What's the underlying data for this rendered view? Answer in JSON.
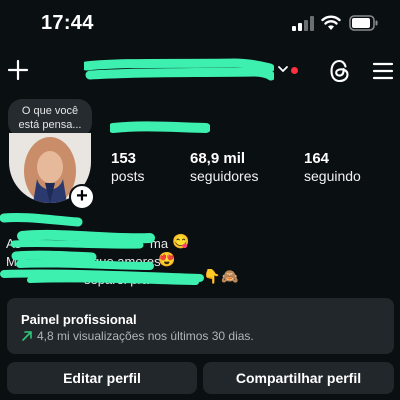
{
  "status_bar": {
    "time": "17:44"
  },
  "header": {
    "icons": [
      "plus-icon",
      "chevron-down-icon",
      "threads-icon",
      "menu-icon"
    ],
    "notification_dot_color": "#ff3040"
  },
  "note": {
    "text_line1": "O que você",
    "text_line2": "está pensa..."
  },
  "stats": {
    "posts_count": "153",
    "posts_label": "posts",
    "followers_count": "68,9 mil",
    "followers_label": "seguidores",
    "following_count": "164",
    "following_label": "seguindo"
  },
  "bio": {
    "line2_prefix": "As",
    "line2_suffix": "ma",
    "line3_prefix": "M",
    "line3_suffix": "que amores",
    "line4_suffix": "separei pra",
    "emoji1": "😋",
    "emoji2": "😍",
    "emoji3": "👇",
    "emoji4": "🙈"
  },
  "dashboard": {
    "title": "Painel profissional",
    "subtitle": "4,8 mi visualizações nos últimos 30 dias.",
    "arrow_color": "#2ec77a"
  },
  "buttons": {
    "edit_profile": "Editar perfil",
    "share_profile": "Compartilhar perfil"
  },
  "colors": {
    "background": "#0a0f12",
    "redaction": "#3ef0b0",
    "card": "#22272b"
  }
}
